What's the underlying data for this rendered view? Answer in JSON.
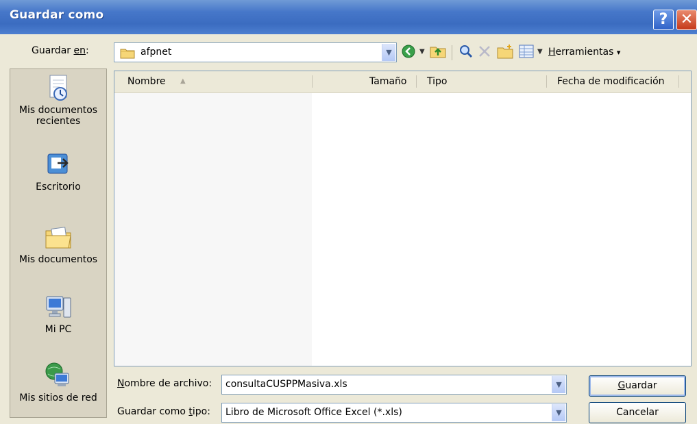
{
  "window": {
    "title": "Guardar como"
  },
  "titlebar": {
    "help": "?",
    "close": "✕"
  },
  "location": {
    "label_pre": "Guardar ",
    "label_u": "en",
    "label_post": ":",
    "folder": "afpnet"
  },
  "toolbar": {
    "tools_pre": "",
    "tools_u": "H",
    "tools_post": "erramientas",
    "tools_arrow": "▾"
  },
  "columns": {
    "name": "Nombre",
    "size": "Tamaño",
    "type": "Tipo",
    "date": "Fecha de modificación"
  },
  "places": [
    {
      "label_line1": "Mis documentos",
      "label_line2": "recientes",
      "icon": "recent-documents-icon"
    },
    {
      "label_line1": "Escritorio",
      "label_line2": "",
      "icon": "desktop-icon"
    },
    {
      "label_line1": "Mis documentos",
      "label_line2": "",
      "icon": "my-documents-icon"
    },
    {
      "label_line1": "Mi PC",
      "label_line2": "",
      "icon": "my-computer-icon"
    },
    {
      "label_line1": "Mis sitios de red",
      "label_line2": "",
      "icon": "network-places-icon"
    }
  ],
  "filename": {
    "label_u": "N",
    "label_rest": "ombre de archivo:",
    "value": "consultaCUSPPMasiva.xls"
  },
  "filetype": {
    "label_pre": "Guardar como ",
    "label_u": "t",
    "label_post": "ipo:",
    "value": "Libro de Microsoft Office Excel (*.xls)"
  },
  "buttons": {
    "save_u": "G",
    "save_rest": "uardar",
    "cancel": "Cancelar"
  }
}
